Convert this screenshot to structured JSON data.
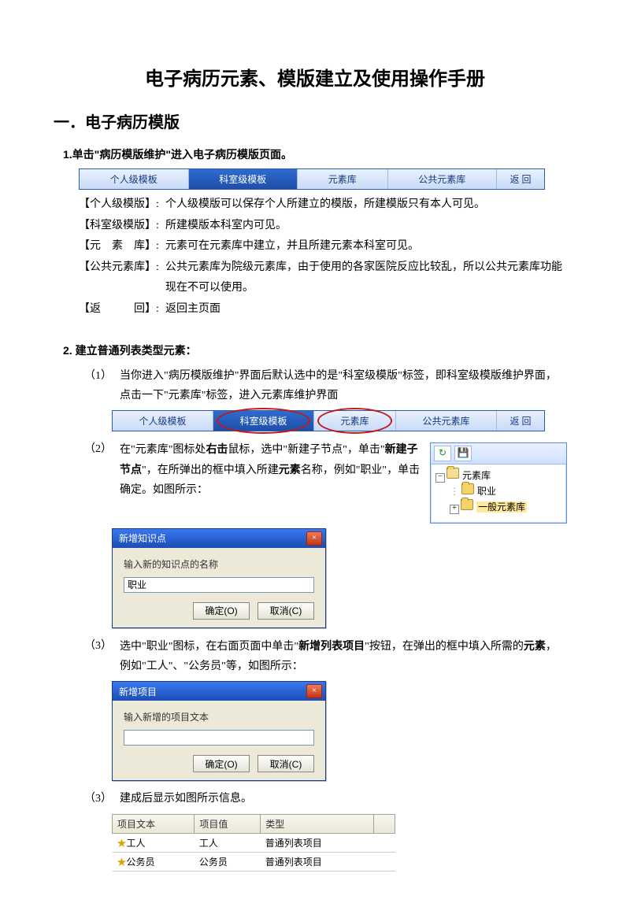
{
  "title": "电子病历元素、模版建立及使用操作手册",
  "section1": {
    "heading": "一．电子病历模版",
    "sub1": "1.单击\"病历模版维护\"进入电子病历模版页面。",
    "sub2": "2. 建立普通列表类型元素："
  },
  "tabs": {
    "personal": "个人级模板",
    "dept": "科室级模板",
    "elemLib": "元素库",
    "pubElem": "公共元素库",
    "back": "返 回"
  },
  "defs": {
    "personal_label": "【个人级模版】:",
    "personal_body": "个人级模版可以保存个人所建立的模版，所建模版只有本人可见。",
    "dept_label": "【科室级模版】:",
    "dept_body": "所建模版本科室内可见。",
    "elem_label": "【元　素　库】:",
    "elem_body": "元素可在元素库中建立，并且所建元素本科室可见。",
    "pub_label": "【公共元素库】:",
    "pub_body": "公共元素库为院级元素库，由于使用的各家医院反应比较乱，所以公共元素库功能现在不可以使用。",
    "back_label": "【返　　　回】:",
    "back_body": "返回主页面"
  },
  "steps": {
    "s1_num": "（1）",
    "s1_body": "当你进入\"病历模版维护\"界面后默认选中的是\"科室级模版\"标签，即科室级模版维护界面，点击一下\"元素库\"标签，进入元素库维护界面",
    "s2_num": "（2）",
    "s2_body_a": "在\"元素库\"图标处",
    "s2_body_b": "右击",
    "s2_body_c": "鼠标，选中\"新建子节点\"，单击\"",
    "s2_body_d": "新建子节点",
    "s2_body_e": "\"，在所弹出的框中填入所建",
    "s2_body_f": "元素",
    "s2_body_g": "名称，例如\"职业\"，单击确定。如图所示：",
    "s3_num": "（3）",
    "s3_body_a": "选中\"职业\"图标，在右面页面中单击\"",
    "s3_body_b": "新增列表项目",
    "s3_body_c": "\"按钮，在弹出的框中填入所需的",
    "s3_body_d": "元素",
    "s3_body_e": "，例如\"工人\"、\"公务员\"等，如图所示：",
    "s4_num": "（3）",
    "s4_body": "建成后显示如图所示信息。"
  },
  "dialog1": {
    "title": "新增知识点",
    "prompt": "输入新的知识点的名称",
    "value": "职业",
    "ok": "确定(O)",
    "cancel": "取消(C)"
  },
  "dialog2": {
    "title": "新增项目",
    "prompt": "输入新增的项目文本",
    "value": "",
    "ok": "确定(O)",
    "cancel": "取消(C)"
  },
  "tree": {
    "refresh_icon": "↻",
    "save_icon": "💾",
    "root": "元素库",
    "child1": "职业",
    "child2": "一般元素库"
  },
  "result_table": {
    "headers": [
      "项目文本",
      "项目值",
      "类型"
    ],
    "rows": [
      {
        "star": "★",
        "t": "工人",
        "v": "工人",
        "k": "普通列表项目"
      },
      {
        "star": "★",
        "t": "公务员",
        "v": "公务员",
        "k": "普通列表项目"
      }
    ]
  }
}
